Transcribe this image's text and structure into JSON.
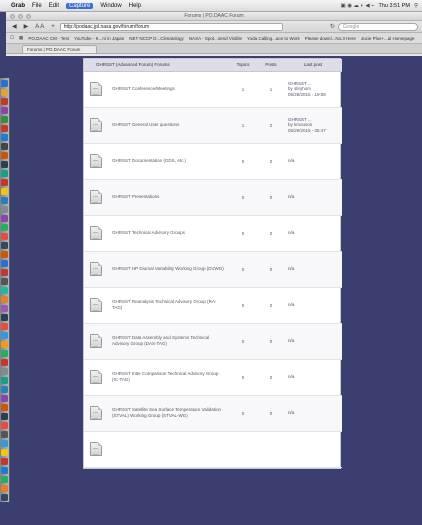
{
  "menubar": {
    "app_name": "Grab",
    "items": [
      "File",
      "Edit",
      "Capture",
      "Window",
      "Help"
    ],
    "clock": "Thu 3:51 PM"
  },
  "browser": {
    "window_title": "Forums | PO.DAAC Forum",
    "url": "http://podaac.jpl.nasa.gov/forum/forum",
    "search_placeholder": "Google",
    "bookmarks": [
      "PO.DAAC CM - Test",
      "YouTube - K...ni in Japan",
      "NET NCCP D...Climatology",
      "NASA - Spot...send Visible",
      "Yoda Calling...ace to Work",
      "Please downl...No.3 Here",
      "Jucie Plus+...al Homepage"
    ],
    "tab_label": "Forums | PO.DAAC Forum"
  },
  "forum": {
    "columns": {
      "forum": "GHRSST (Advanced Forum) Forums",
      "topics": "Topics",
      "posts": "Posts",
      "last_post": "Last post"
    },
    "rows": [
      {
        "name": "GHRSST Conference/Meetings",
        "topics": "1",
        "posts": "1",
        "last_title": "GHRSST ...",
        "last_by": "by stiryhom",
        "last_date": "05/28/2015 - 19:08"
      },
      {
        "name": "GHRSST General User questions",
        "topics": "1",
        "posts": "2",
        "last_title": "GHRSST ...",
        "last_by": "by kmouson",
        "last_date": "05/29/2015 - 05:47"
      },
      {
        "name": "GHRSST Documentation (GDS, etc.)",
        "topics": "0",
        "posts": "0",
        "last_title": "n/a",
        "last_by": "",
        "last_date": ""
      },
      {
        "name": "GHRSST Presentations",
        "topics": "0",
        "posts": "0",
        "last_title": "n/a",
        "last_by": "",
        "last_date": ""
      },
      {
        "name": "GHRSST Technical Advisory Groups",
        "topics": "0",
        "posts": "0",
        "last_title": "n/a",
        "last_by": "",
        "last_date": ""
      },
      {
        "name": "GHRSST HP Diurnal Variability Working Group (DVWG)",
        "topics": "0",
        "posts": "0",
        "last_title": "n/a",
        "last_by": "",
        "last_date": ""
      },
      {
        "name": "GHRSST Reanalysis Technical Advisory Group (RA-TAG)",
        "topics": "0",
        "posts": "0",
        "last_title": "n/a",
        "last_by": "",
        "last_date": ""
      },
      {
        "name": "GHRSST Data Assembly and Systems Technical Advisory Group (DAS-TAG)",
        "topics": "0",
        "posts": "0",
        "last_title": "n/a",
        "last_by": "",
        "last_date": ""
      },
      {
        "name": "GHRSST Inter Comparison Technical Advisory Group (IC-TAG)",
        "topics": "0",
        "posts": "0",
        "last_title": "n/a",
        "last_by": "",
        "last_date": ""
      },
      {
        "name": "GHRSST Satellite Sea Surface Temperature Validation (STVAL) Working Group (STVAL-WG)",
        "topics": "0",
        "posts": "0",
        "last_title": "n/a",
        "last_by": "",
        "last_date": ""
      },
      {
        "name": "",
        "topics": "",
        "posts": "",
        "last_title": "",
        "last_by": "",
        "last_date": ""
      }
    ]
  },
  "dock_colors": [
    "#2a6fd1",
    "#e2a23a",
    "#c0392b",
    "#8e44ad",
    "#3c8d3c",
    "#c0392b",
    "#1d7dd1",
    "#444444",
    "#d35400",
    "#2c3e50",
    "#16a085",
    "#c0392b",
    "#f1c40f",
    "#2980b9",
    "#7f8c8d",
    "#8e44ad",
    "#27ae60",
    "#e74c3c",
    "#34495e",
    "#d35400",
    "#2a6fd1",
    "#c0392b",
    "#555555",
    "#1abc9c",
    "#e67e22",
    "#9b59b6",
    "#2c3e50",
    "#e74c3c",
    "#3498db",
    "#f39c12",
    "#27ae60",
    "#c0392b",
    "#7f8c8d",
    "#16a085",
    "#2980b9",
    "#8e44ad",
    "#d35400",
    "#2c3e50",
    "#e74c3c",
    "#555555",
    "#3498db",
    "#f1c40f",
    "#c0392b",
    "#1d7dd1",
    "#27ae60",
    "#e67e22",
    "#34495e",
    "#9b59b6",
    "#2a6fd1",
    "#e74c3c",
    "#7f8c8d"
  ]
}
